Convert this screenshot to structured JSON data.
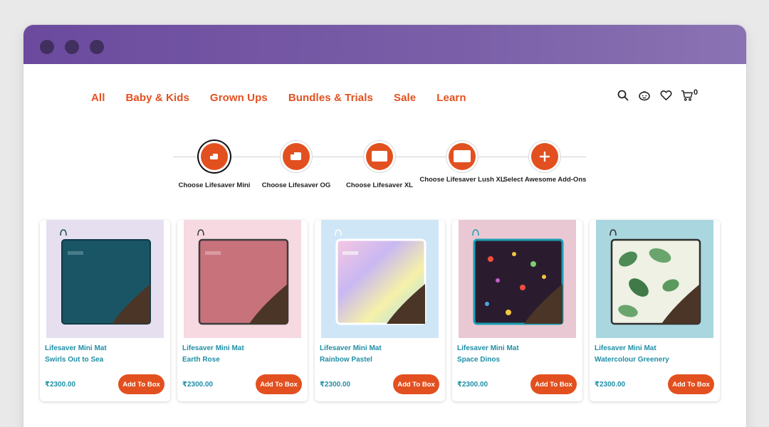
{
  "colors": {
    "accent": "#e3501f",
    "link": "#1f8fa6",
    "titlebar": "#6b4a9e"
  },
  "nav": {
    "items": [
      {
        "label": "All"
      },
      {
        "label": "Baby & Kids"
      },
      {
        "label": "Grown Ups"
      },
      {
        "label": "Bundles & Trials"
      },
      {
        "label": "Sale"
      },
      {
        "label": "Learn"
      }
    ]
  },
  "header_icons": {
    "search": "search-icon",
    "account": "face-icon",
    "wishlist": "heart-icon",
    "cart": "cart-icon",
    "cart_count": "0"
  },
  "steps": [
    {
      "label": "Choose Lifesaver Mini",
      "icon": "mat-mini-icon",
      "active": true
    },
    {
      "label": "Choose Lifesaver OG",
      "icon": "mat-og-icon"
    },
    {
      "label": "Choose Lifesaver XL",
      "icon": "mat-xl-icon"
    },
    {
      "label": "Choose Lifesaver Lush XL",
      "icon": "mat-lush-xl-icon"
    },
    {
      "label": "Select Awesome Add-Ons",
      "icon": "plus-icon"
    }
  ],
  "products": [
    {
      "title": "Lifesaver Mini Mat",
      "variant": "Swirls Out to Sea",
      "price": "₹2300.00",
      "button": "Add To Box"
    },
    {
      "title": "Lifesaver Mini Mat",
      "variant": "Earth Rose",
      "price": "₹2300.00",
      "button": "Add To Box"
    },
    {
      "title": "Lifesaver Mini Mat",
      "variant": "Rainbow Pastel",
      "price": "₹2300.00",
      "button": "Add To Box"
    },
    {
      "title": "Lifesaver Mini Mat",
      "variant": "Space Dinos",
      "price": "₹2300.00",
      "button": "Add To Box"
    },
    {
      "title": "Lifesaver Mini Mat",
      "variant": "Watercolour Greenery",
      "price": "₹2300.00",
      "button": "Add To Box"
    }
  ]
}
